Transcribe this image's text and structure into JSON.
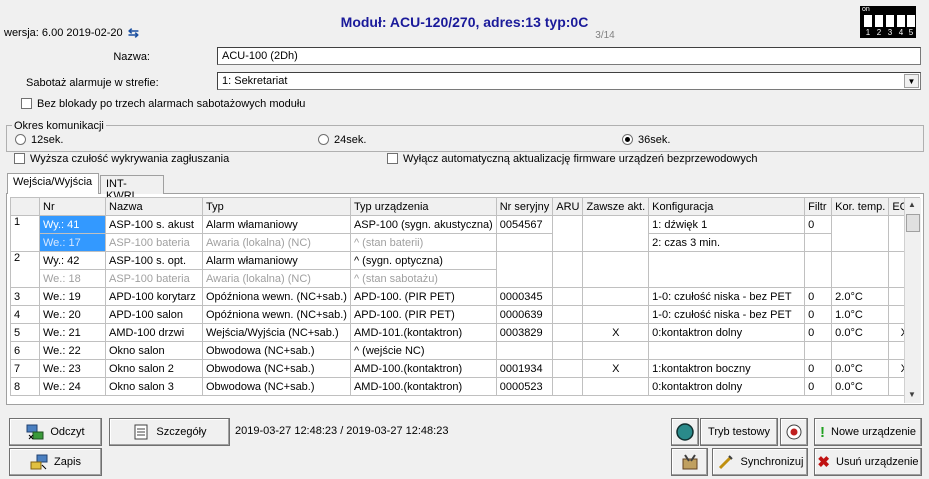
{
  "header": {
    "version": "wersja: 6.00 2019-02-20",
    "title": "Moduł: ACU-120/270, adres:13 typ:0C",
    "pager": "3/14",
    "dip_on": "on",
    "dip_numbers": [
      "1",
      "2",
      "3",
      "4",
      "5"
    ]
  },
  "form": {
    "name_label": "Nazwa:",
    "name_value": "ACU-100  (2Dh)",
    "tamper_label": "Sabotaż alarmuje w strefie:",
    "tamper_value": "1: Sekretariat",
    "no_block_label": "Bez blokady po trzech alarmach sabotażowych modułu",
    "comm_group_title": "Okres komunikacji",
    "comm_options": [
      "12sek.",
      "24sek.",
      "36sek."
    ],
    "comm_selected": "36sek.",
    "jamming_label": "Wyższa czułość wykrywania zagłuszania",
    "firmware_label": "Wyłącz automatyczną aktualizację firmware urządzeń bezprzewodowych"
  },
  "tabs": [
    "Wejścia/Wyjścia",
    "INT-KWRL"
  ],
  "table": {
    "columns": [
      "",
      "Nr",
      "Nazwa",
      "Typ",
      "Typ urządzenia",
      "Nr seryjny",
      "ARU",
      "Zawsze akt.",
      "Konfiguracja",
      "Filtr",
      "Kor. temp.",
      "ECO"
    ],
    "rows": [
      {
        "idx": "1",
        "nr": "Wy.: 41",
        "nazwa": "ASP-100 s. akust",
        "typ": "Alarm włamaniowy",
        "dev": "ASP-100  (sygn. akustyczna)",
        "serial": "0054567",
        "aru": "",
        "always": "",
        "conf": "1: dźwięk 1",
        "filtr": "0",
        "kor": "",
        "eco": "",
        "sub": {
          "nr": "We.: 17",
          "nazwa": "ASP-100 bateria",
          "typ": "Awaria (lokalna) (NC)",
          "dev": "^                   (stan baterii)",
          "conf": "2: czas 3 min."
        }
      },
      {
        "idx": "2",
        "nr": "Wy.: 42",
        "nazwa": "ASP-100 s. opt.",
        "typ": "Alarm włamaniowy",
        "dev": "^                   (sygn. optyczna)",
        "serial": "",
        "aru": "",
        "always": "",
        "conf": "",
        "filtr": "",
        "kor": "",
        "eco": "",
        "sub": {
          "nr": "We.: 18",
          "nazwa": "ASP-100 bateria",
          "typ": "Awaria (lokalna) (NC)",
          "dev": "^                   (stan sabotażu)",
          "conf": ""
        }
      },
      {
        "idx": "3",
        "nr": "We.: 19",
        "nazwa": "APD-100 korytarz",
        "typ": "Opóźniona wewn. (NC+sab.)",
        "dev": "APD-100. (PIR PET)",
        "serial": "0000345",
        "aru": "",
        "always": "",
        "conf": "1-0: czułość niska - bez PET",
        "filtr": "0",
        "kor": "2.0°C",
        "eco": ""
      },
      {
        "idx": "4",
        "nr": "We.: 20",
        "nazwa": "APD-100 salon",
        "typ": "Opóźniona wewn. (NC+sab.)",
        "dev": "APD-100. (PIR PET)",
        "serial": "0000639",
        "aru": "",
        "always": "",
        "conf": "1-0: czułość niska - bez PET",
        "filtr": "0",
        "kor": "1.0°C",
        "eco": ""
      },
      {
        "idx": "5",
        "nr": "We.: 21",
        "nazwa": "AMD-100 drzwi",
        "typ": "Wejścia/Wyjścia (NC+sab.)",
        "dev": "AMD-101.(kontaktron)",
        "serial": "0003829",
        "aru": "",
        "always": "X",
        "conf": "0:kontaktron dolny",
        "filtr": "0",
        "kor": "0.0°C",
        "eco": "X"
      },
      {
        "idx": "6",
        "nr": "We.: 22",
        "nazwa": "Okno salon",
        "typ": "Obwodowa (NC+sab.)",
        "dev": "^                (wejście NC)",
        "serial": "",
        "aru": "",
        "always": "",
        "conf": "",
        "filtr": "",
        "kor": "",
        "eco": ""
      },
      {
        "idx": "7",
        "nr": "We.: 23",
        "nazwa": "Okno salon 2",
        "typ": "Obwodowa (NC+sab.)",
        "dev": "AMD-100.(kontaktron)",
        "serial": "0001934",
        "aru": "",
        "always": "X",
        "conf": "1:kontaktron boczny",
        "filtr": "0",
        "kor": "0.0°C",
        "eco": "X"
      },
      {
        "idx": "8",
        "nr": "We.: 24",
        "nazwa": "Okno salon 3",
        "typ": "Obwodowa (NC+sab.)",
        "dev": "AMD-100.(kontaktron)",
        "serial": "0000523",
        "aru": "",
        "always": "",
        "conf": "0:kontaktron dolny",
        "filtr": "0",
        "kor": "0.0°C",
        "eco": ""
      }
    ]
  },
  "footer": {
    "read_label": "Odczyt",
    "details_label": "Szczegóły",
    "timestamps": "2019-03-27 12:48:23 / 2019-03-27 12:48:23",
    "write_label": "Zapis",
    "test_mode_label": "Tryb testowy",
    "sync_label": "Synchronizuj",
    "new_device_label": "Nowe urządzenie",
    "remove_device_label": "Usuń urządzenie"
  },
  "colors": {
    "title": "#1a1a9a",
    "selection": "#3399ff"
  }
}
